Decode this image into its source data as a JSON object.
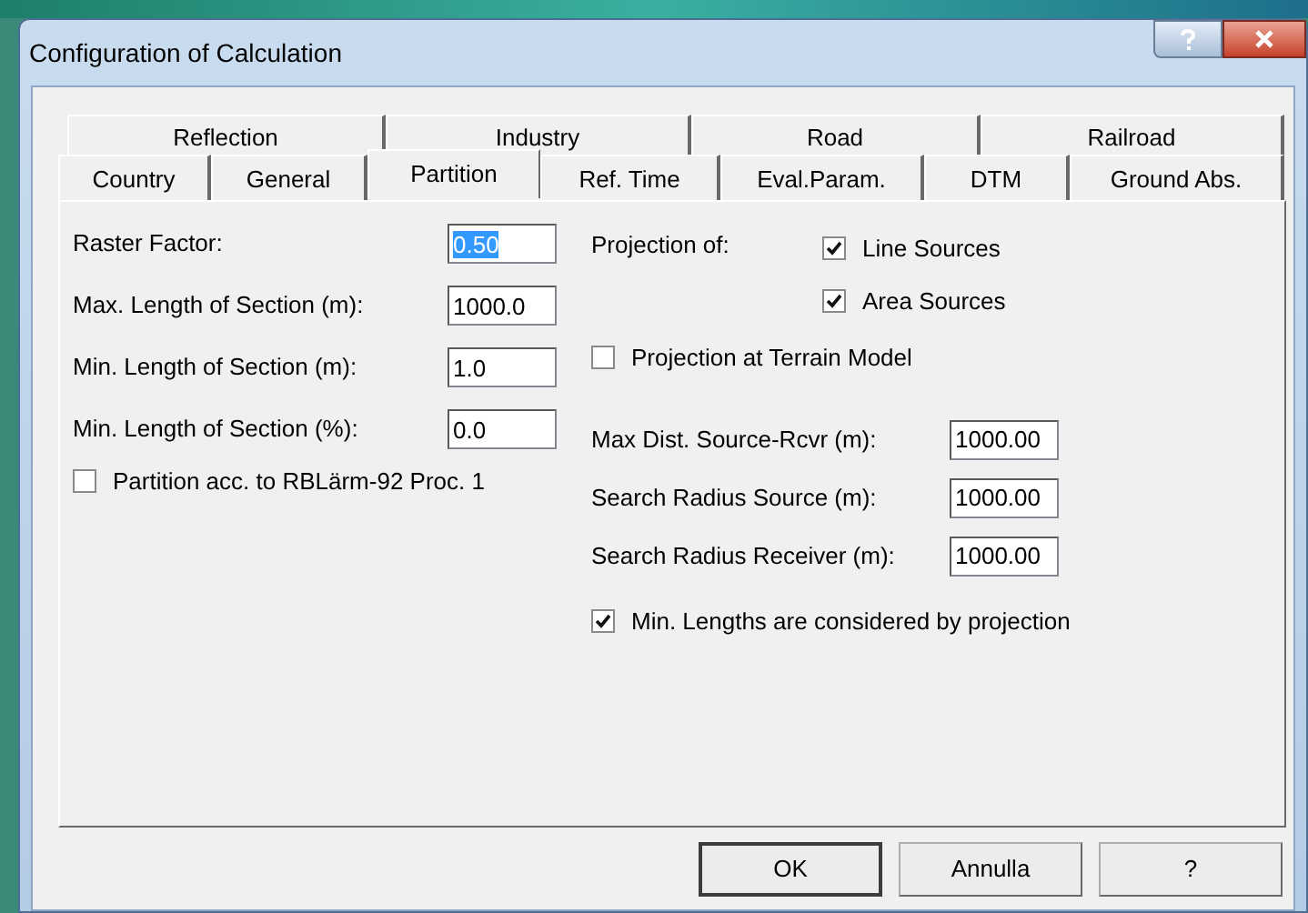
{
  "window": {
    "title": "Configuration of Calculation"
  },
  "tab_rows": [
    [
      {
        "label": "Reflection",
        "selected": false
      },
      {
        "label": "Industry",
        "selected": false
      },
      {
        "label": "Road",
        "selected": false
      },
      {
        "label": "Railroad",
        "selected": false
      }
    ],
    [
      {
        "label": "Country",
        "selected": false
      },
      {
        "label": "General",
        "selected": false
      },
      {
        "label": "Partition",
        "selected": true
      },
      {
        "label": "Ref. Time",
        "selected": false
      },
      {
        "label": "Eval.Param.",
        "selected": false
      },
      {
        "label": "DTM",
        "selected": false
      },
      {
        "label": "Ground Abs.",
        "selected": false
      }
    ]
  ],
  "left_fields": [
    {
      "label": "Raster Factor:",
      "value": "0.50",
      "text_selected": true
    },
    {
      "label": "Max. Length of Section (m):",
      "value": "1000.0",
      "text_selected": false
    },
    {
      "label": "Min. Length of Section (m):",
      "value": "1.0",
      "text_selected": false
    },
    {
      "label": "Min. Length of Section (%):",
      "value": "0.0",
      "text_selected": false
    }
  ],
  "partition_checkbox": {
    "label": "Partition acc. to RBLärm-92 Proc. 1",
    "checked": false
  },
  "projection": {
    "label": "Projection of:",
    "options": [
      {
        "label": "Line Sources",
        "checked": true
      },
      {
        "label": "Area Sources",
        "checked": true
      }
    ]
  },
  "terrain_checkbox": {
    "label": "Projection at Terrain Model",
    "checked": false
  },
  "right_fields": [
    {
      "label": "Max Dist. Source-Rcvr (m):",
      "value": "1000.00"
    },
    {
      "label": "Search Radius Source (m):",
      "value": "1000.00"
    },
    {
      "label": "Search Radius Receiver (m):",
      "value": "1000.00"
    }
  ],
  "min_lengths_checkbox": {
    "label": "Min. Lengths are considered by projection",
    "checked": true
  },
  "buttons": [
    {
      "label": "OK",
      "default": true
    },
    {
      "label": "Annulla",
      "default": false
    },
    {
      "label": "?",
      "default": false
    }
  ]
}
